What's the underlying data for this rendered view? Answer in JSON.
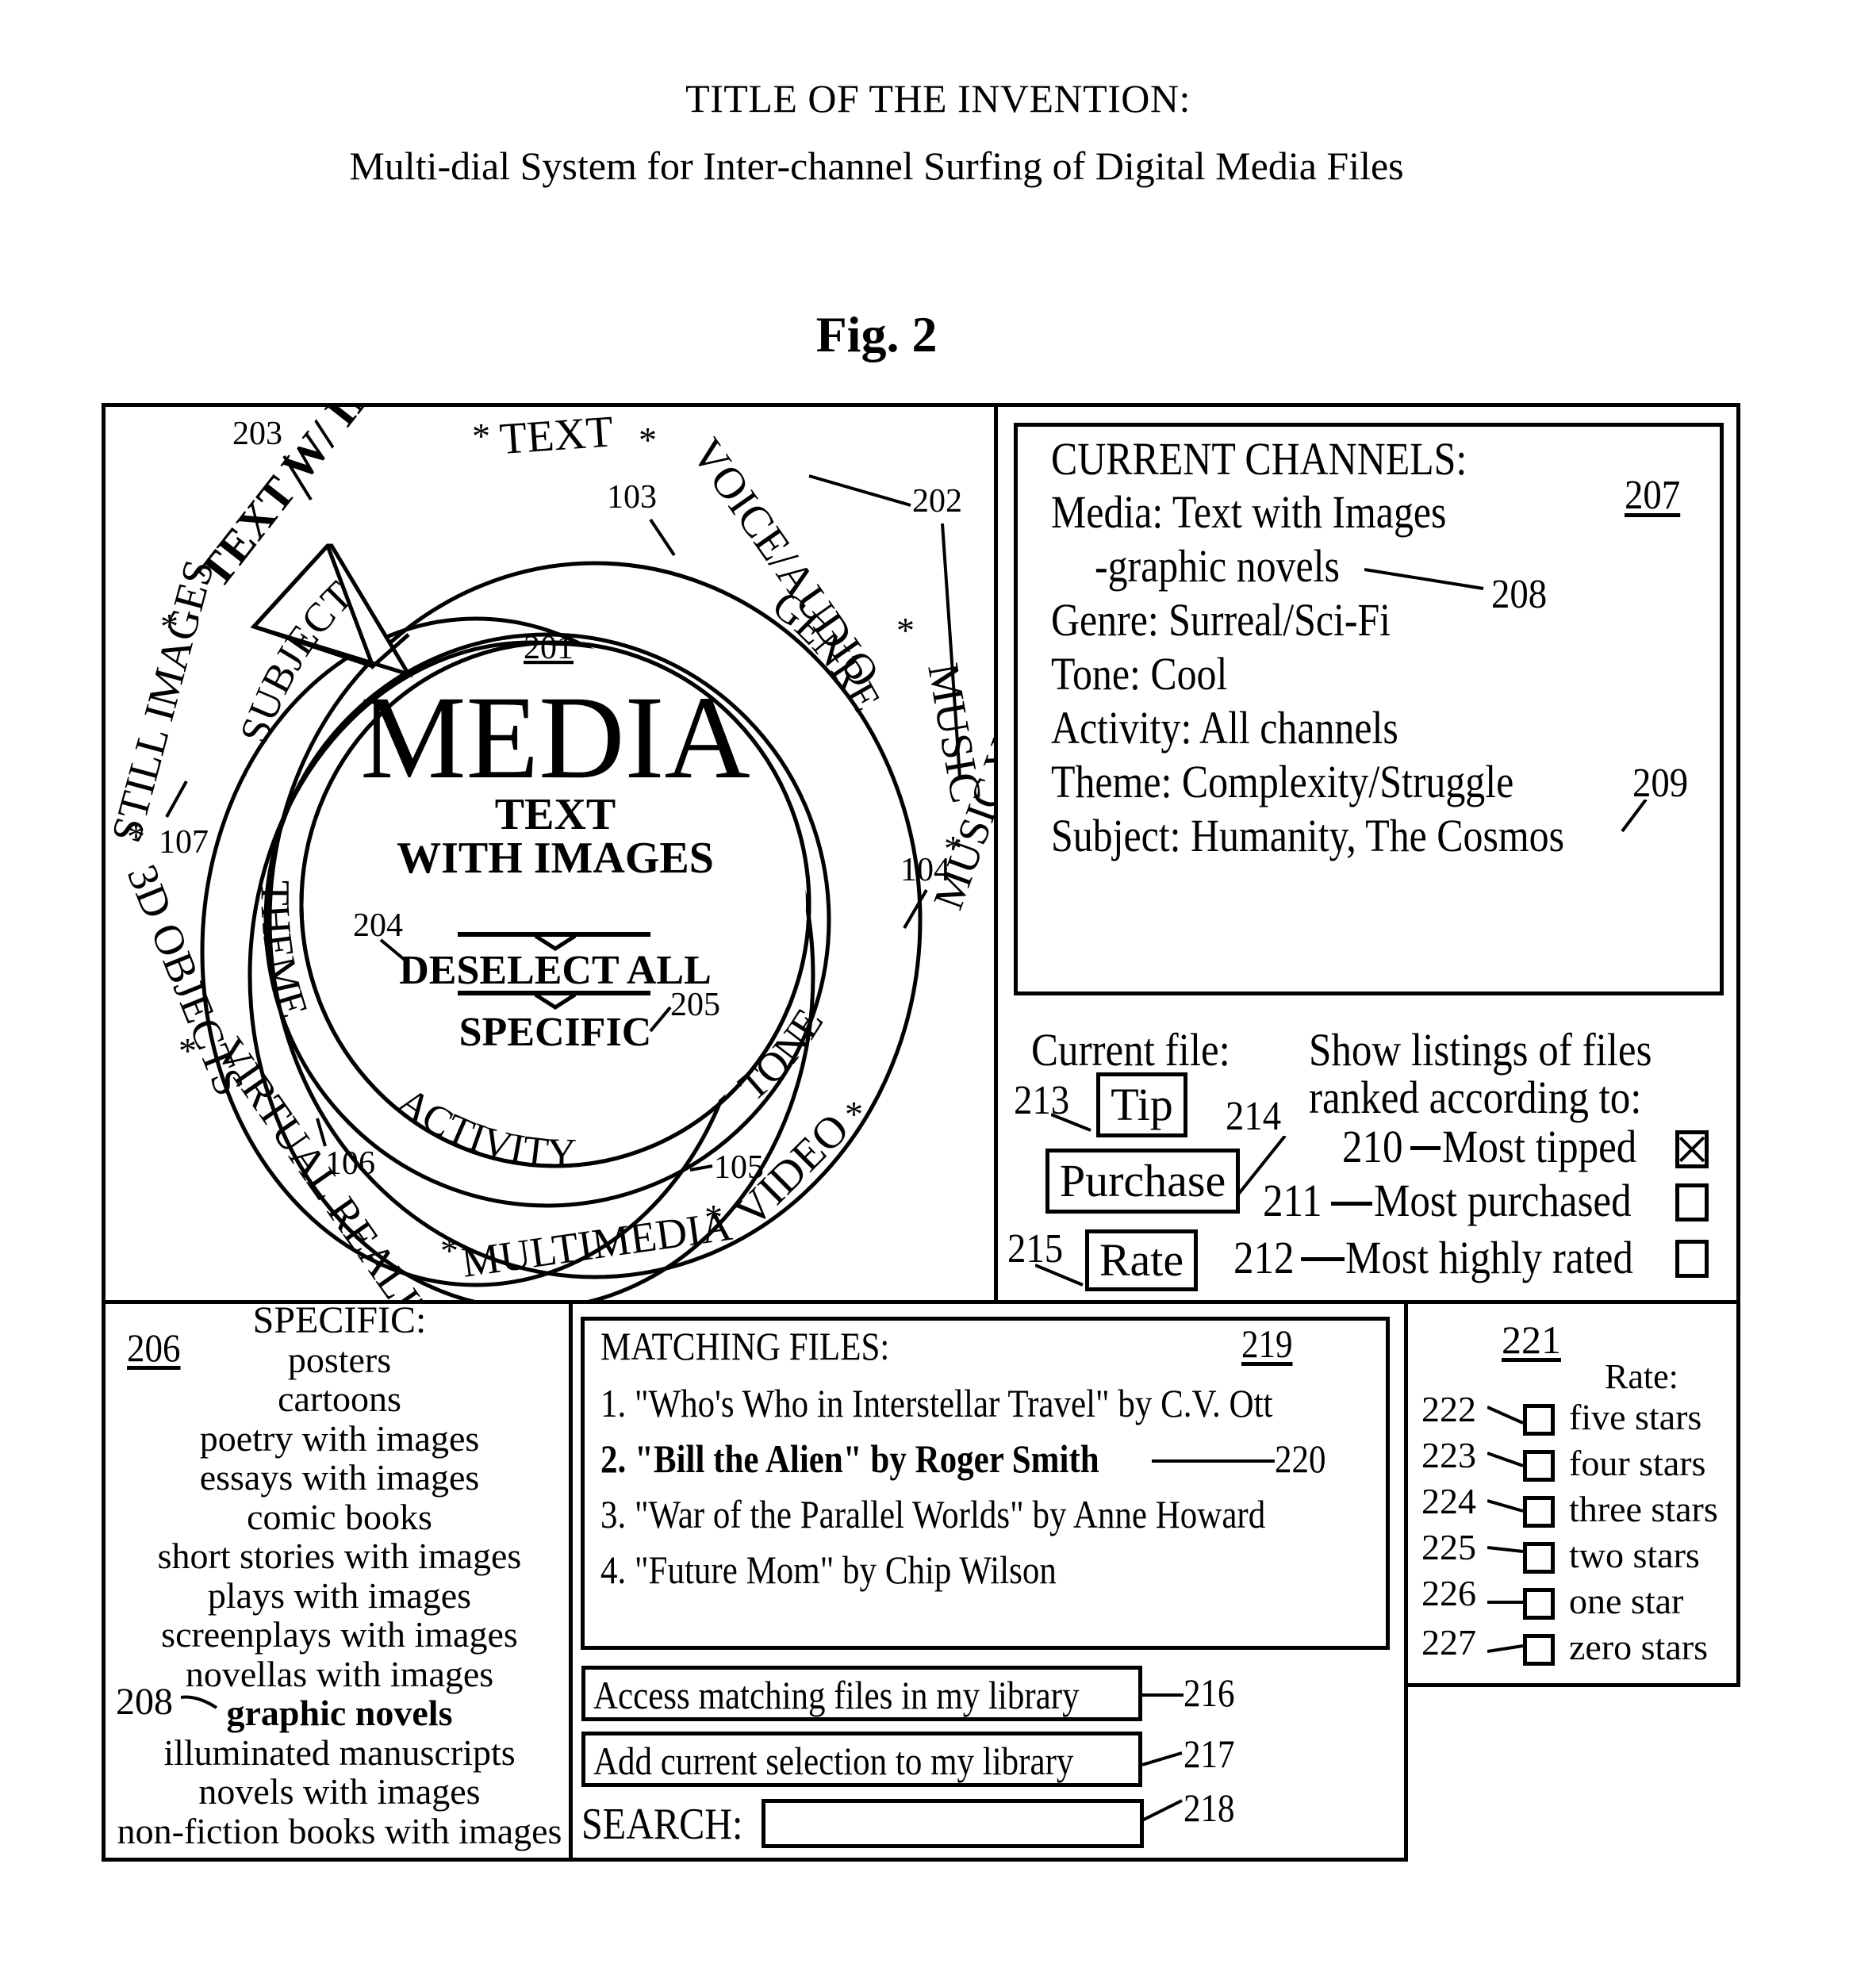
{
  "header": {
    "title_label": "TITLE OF THE INVENTION:",
    "title": "Multi-dial System for Inter-channel Surfing of Digital Media Files",
    "figure_label": "Fig. 2"
  },
  "dial": {
    "outer_ring_ref": "202",
    "outer_ring_items": [
      "TEXT",
      "VOICE/AUDIO",
      "MUSIC",
      "MUSIC VIDEO",
      "VIDEO",
      "MULTIMEDIA",
      "VIRTUAL REALITY",
      "3D OBJECTS",
      "STILL IMAGES",
      "TEXT W/ IMAGES"
    ],
    "selected_outer_item": "TEXT W/ IMAGES",
    "selected_outer_ref": "203",
    "dial_rings": [
      {
        "label": "GENRE",
        "ref": "103"
      },
      {
        "label": "TONE",
        "ref": "104"
      },
      {
        "label": "ACTIVITY",
        "ref": "105"
      },
      {
        "label": "THEME",
        "ref": "106"
      },
      {
        "label": "SUBJECT",
        "ref": "107"
      }
    ],
    "center": {
      "ref": "201",
      "heading": "MEDIA",
      "value_line1": "TEXT",
      "value_line2": "WITH IMAGES",
      "deselect_label": "DESELECT ALL",
      "deselect_ref": "204",
      "specific_label": "SPECIFIC",
      "specific_ref": "205"
    },
    "separator": "*"
  },
  "current_channels": {
    "ref": "207",
    "heading": "CURRENT CHANNELS:",
    "lines": [
      "Media: Text with Images",
      "-graphic novels",
      "Genre: Surreal/Sci-Fi",
      "Tone: Cool",
      "Activity: All channels",
      "Theme: Complexity/Struggle",
      "Subject: Humanity, The Cosmos"
    ],
    "sub_ref": "208",
    "subject_ref": "209"
  },
  "current_file": {
    "label": "Current file:",
    "buttons": [
      {
        "label": "Tip",
        "ref": "213"
      },
      {
        "label": "Purchase",
        "ref": "214"
      },
      {
        "label": "Rate",
        "ref": "215"
      }
    ]
  },
  "ranking": {
    "heading_line1": "Show listings of files",
    "heading_line2": "ranked according to:",
    "options": [
      {
        "ref": "210",
        "label": "Most tipped",
        "checked": true
      },
      {
        "ref": "211",
        "label": "Most purchased",
        "checked": false
      },
      {
        "ref": "212",
        "label": "Most highly rated",
        "checked": false
      }
    ]
  },
  "specific": {
    "ref": "206",
    "heading": "SPECIFIC:",
    "items": [
      "posters",
      "cartoons",
      "poetry with images",
      "essays with images",
      "comic books",
      "short stories with images",
      "plays with images",
      "screenplays with images",
      "novellas with images",
      "graphic novels",
      "illuminated manuscripts",
      "novels with images",
      "non-fiction books with images"
    ],
    "selected_index": 9,
    "selected_ref": "208"
  },
  "matching_files": {
    "heading": "MATCHING FILES:",
    "ref": "219",
    "files": [
      "1. \"Who's Who in Interstellar Travel\" by C.V. Ott",
      "2. \"Bill the Alien\" by Roger Smith",
      "3. \"War of the Parallel Worlds\" by Anne Howard",
      "4. \"Future Mom\" by Chip Wilson"
    ],
    "selected_index": 1,
    "selected_ref": "220"
  },
  "library": {
    "access_label": "Access matching files in my library",
    "access_ref": "216",
    "add_label": "Add current selection to my library",
    "add_ref": "217",
    "search_label": "SEARCH:",
    "search_value": "",
    "search_ref": "218"
  },
  "rate_panel": {
    "ref": "221",
    "heading": "Rate:",
    "options": [
      {
        "ref": "222",
        "label": "five stars",
        "checked": false
      },
      {
        "ref": "223",
        "label": "four stars",
        "checked": false
      },
      {
        "ref": "224",
        "label": "three stars",
        "checked": false
      },
      {
        "ref": "225",
        "label": "two stars",
        "checked": false
      },
      {
        "ref": "226",
        "label": "one star",
        "checked": false
      },
      {
        "ref": "227",
        "label": "zero stars",
        "checked": false
      }
    ]
  }
}
